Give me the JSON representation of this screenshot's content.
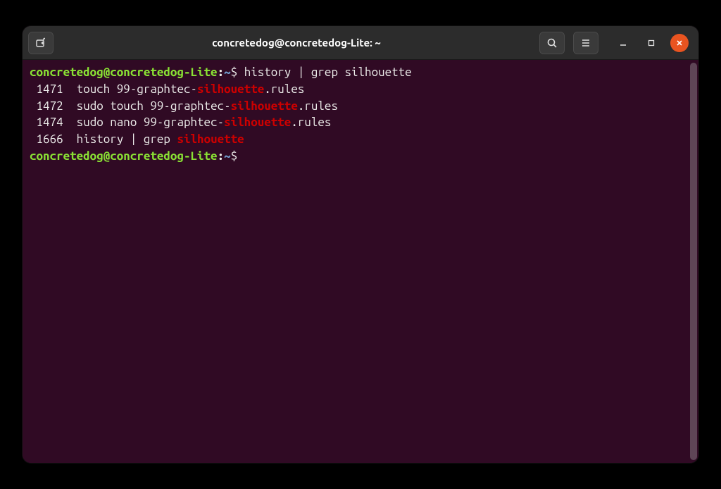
{
  "window": {
    "title": "concretedog@concretedog-Lite: ~"
  },
  "prompt": {
    "user_host": "concretedog@concretedog-Lite",
    "colon": ":",
    "path": "~",
    "dollar": "$"
  },
  "command": "history | grep silhouette",
  "grep_word": "silhouette",
  "history": [
    {
      "num": "1471",
      "pre": "touch 99-graphtec-",
      "post": ".rules"
    },
    {
      "num": "1472",
      "pre": "sudo touch 99-graphtec-",
      "post": ".rules"
    },
    {
      "num": "1474",
      "pre": "sudo nano 99-graphtec-",
      "post": ".rules"
    },
    {
      "num": "1666",
      "pre": "history | grep ",
      "post": ""
    }
  ]
}
